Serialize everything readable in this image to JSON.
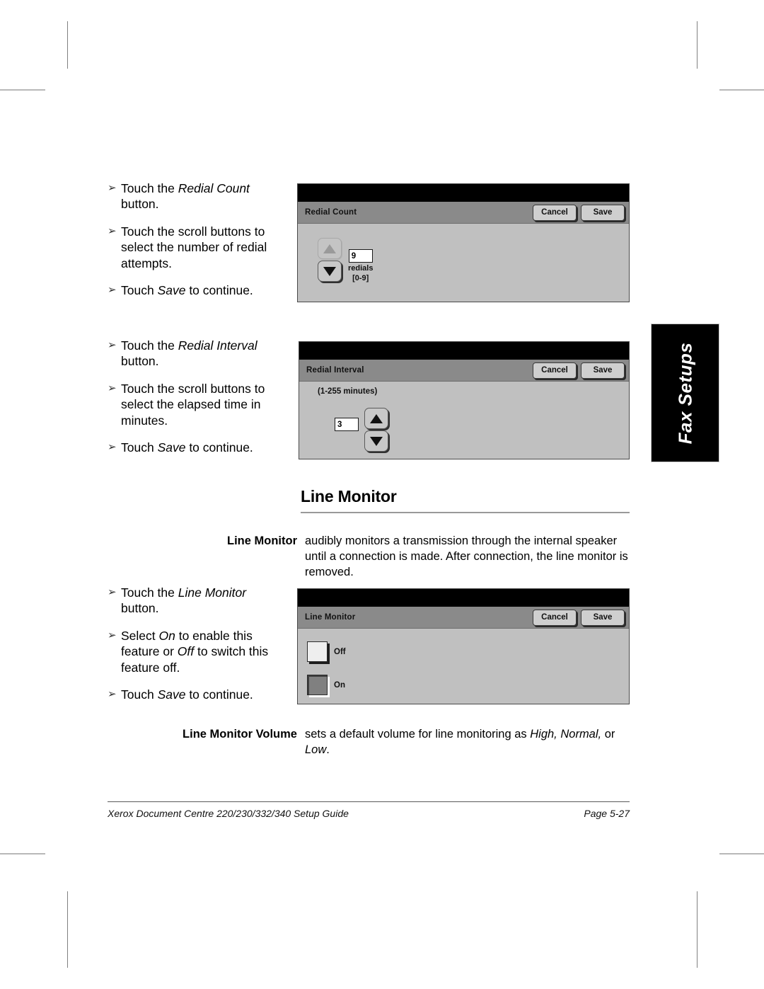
{
  "document": {
    "footer_left": "Xerox Document Centre 220/230/332/340 Setup Guide",
    "footer_right": "Page 5-27",
    "side_tab": "Fax Setups"
  },
  "section": {
    "heading": "Line Monitor"
  },
  "steps": {
    "redial_count": {
      "bullets": [
        {
          "marker": "➢",
          "prefix": "Touch the ",
          "em": "Redial Count",
          "suffix": " button."
        },
        {
          "marker": "➢",
          "prefix": "Touch the scroll buttons to select the number of redial attempts.",
          "em": "",
          "suffix": ""
        },
        {
          "marker": "➢",
          "prefix": "Touch ",
          "em": "Save",
          "suffix": " to continue."
        }
      ]
    },
    "redial_interval": {
      "bullets": [
        {
          "marker": "➢",
          "prefix": "Touch the ",
          "em": "Redial Interval",
          "suffix": " button."
        },
        {
          "marker": "➢",
          "prefix": "Touch the scroll buttons to select the elapsed time in minutes.",
          "em": "",
          "suffix": ""
        },
        {
          "marker": "➢",
          "prefix": "Touch ",
          "em": "Save",
          "suffix": " to continue."
        }
      ]
    },
    "line_monitor": {
      "bullets": [
        {
          "marker": "➢",
          "prefix": "Touch the ",
          "em": "Line Monitor",
          "suffix": " button."
        },
        {
          "marker": "➢",
          "prefix": "Select ",
          "em": "On",
          "suffix": " to enable this feature or ",
          "em2": "Off",
          "suffix2": " to switch this feature off."
        },
        {
          "marker": "➢",
          "prefix": "Touch ",
          "em": "Save",
          "suffix": " to continue."
        }
      ]
    }
  },
  "panels": {
    "redial_count": {
      "title": "Redial Count",
      "cancel_label": "Cancel",
      "save_label": "Save",
      "value": "9",
      "unit": "redials",
      "range": "[0-9]",
      "up_enabled": false,
      "down_enabled": true
    },
    "redial_interval": {
      "title": "Redial Interval",
      "cancel_label": "Cancel",
      "save_label": "Save",
      "hint": "(1-255 minutes)",
      "value": "3",
      "up_enabled": true,
      "down_enabled": true
    },
    "line_monitor": {
      "title": "Line Monitor",
      "cancel_label": "Cancel",
      "save_label": "Save",
      "option_off_label": "Off",
      "option_on_label": "On",
      "selected": "On"
    }
  },
  "definitions": [
    {
      "term": "Line Monitor",
      "parts": [
        {
          "text": "audibly monitors a transmission through the internal speaker until a connection is made. After connection, the line monitor is removed.",
          "italic": false
        }
      ]
    },
    {
      "term": "Line Monitor Volume",
      "parts": [
        {
          "text": "sets a default volume for line monitoring as ",
          "italic": false
        },
        {
          "text": "High, Normal,",
          "italic": true
        },
        {
          "text": " or ",
          "italic": false
        },
        {
          "text": "Low",
          "italic": true
        },
        {
          "text": ".",
          "italic": false
        }
      ]
    }
  ],
  "colors": {
    "panel_body": "#c0c0c0",
    "panel_titlebar": "#8a8a8a",
    "panel_blackbar": "#000000",
    "tab_background": "#000000"
  }
}
